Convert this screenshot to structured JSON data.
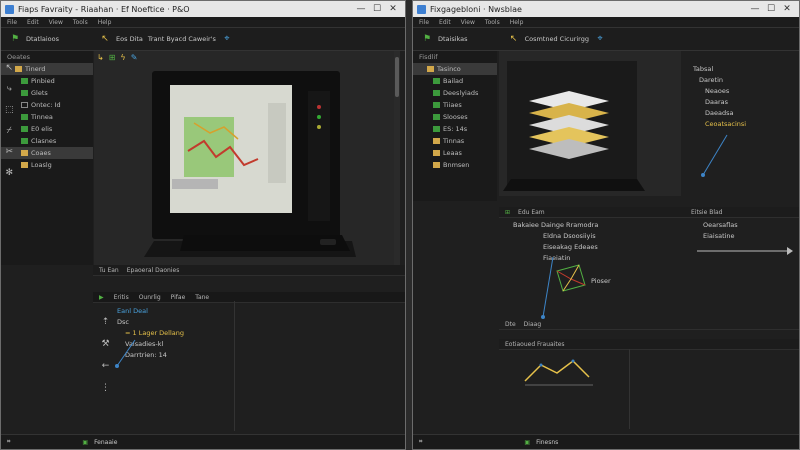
{
  "left_window": {
    "title": "Fiaps Favraity - Riaahan · Ef Noeftice · P&O",
    "menu": [
      "File",
      "Edit",
      "View",
      "Tools",
      "Help"
    ],
    "toolbar_label": "Dtatlaioos",
    "editor_tab": "Eos Dita",
    "editor_title": "Trant Byacd Caweir's",
    "tree_header": "Oeates",
    "tree_items": [
      {
        "label": "Tinerd",
        "icon": "fold",
        "selected": true
      },
      {
        "label": "Pinbied",
        "icon": "grn"
      },
      {
        "label": "Glets",
        "icon": "grn"
      },
      {
        "label": "Ontec: Id",
        "icon": "gry"
      },
      {
        "label": "Tinnea",
        "icon": "grn"
      },
      {
        "label": "E0 elis",
        "icon": "grn"
      },
      {
        "label": "Clasnes",
        "icon": "grn"
      },
      {
        "label": "Coaes",
        "icon": "fold",
        "selected": true
      },
      {
        "label": "Loaslg",
        "icon": "fold"
      }
    ],
    "bottom_panel_tabs": [
      "Tu Ean",
      "Epaoeral Daonies"
    ],
    "bottom_panel_toolbar": [
      "Eritis",
      "Ounrlig",
      "Pifae",
      "Tane"
    ],
    "code_lines": [
      {
        "text": "Eanl Deal",
        "color": "blue"
      },
      {
        "text": "Dsc",
        "color": "plain"
      },
      {
        "text": "= 1 Lager Dellang",
        "color": "yellow"
      },
      {
        "text": "Vaisadies-kl",
        "color": "plain"
      },
      {
        "text": "Darrtrien: 14",
        "color": "plain"
      }
    ],
    "status": "Fenaaie"
  },
  "right_window": {
    "title": "Fixgagebloni · Nwsblae",
    "menu": [
      "File",
      "Edit",
      "View",
      "Tools",
      "Help"
    ],
    "toolbar_label": "Dtaisikas",
    "editor_title": "Cosmtned Cicurirgg",
    "tree_header": "Fisdlif",
    "tree_items": [
      {
        "label": "Tasinco",
        "icon": "fold",
        "selected": true
      },
      {
        "label": "Bailad",
        "icon": "grn"
      },
      {
        "label": "Deeslyiads",
        "icon": "grn"
      },
      {
        "label": "Tiiaes",
        "icon": "grn"
      },
      {
        "label": "Slooses",
        "icon": "grn"
      },
      {
        "label": "ES: 14s",
        "icon": "grn"
      },
      {
        "label": "Tinnas",
        "icon": "fold"
      },
      {
        "label": "Leaas",
        "icon": "fold"
      },
      {
        "label": "Bnmsen",
        "icon": "fold"
      }
    ],
    "hierarchy": [
      "Tabsal",
      "Daretin",
      "Neaoes",
      "Daaras",
      "Daeadsa",
      "Ceoatsacinsi"
    ],
    "mid_left_header": "Edu Eam",
    "mid_left_lines": [
      "Bakaiee Dainge Rramodra",
      "Eldna Dsoosiiyis",
      "Eiseakag Edeaes",
      "Fiaeiatin"
    ],
    "mid_right_header": "Eitsie Blad",
    "mid_right_lines": [
      "Oearsaflas",
      "Eiaisatine"
    ],
    "mid_node_label": "Pioser",
    "mid_bottom": [
      "Dte",
      "Diaag"
    ],
    "lower_header": "Eotiaoued Frauaites",
    "status": "Finesns"
  }
}
